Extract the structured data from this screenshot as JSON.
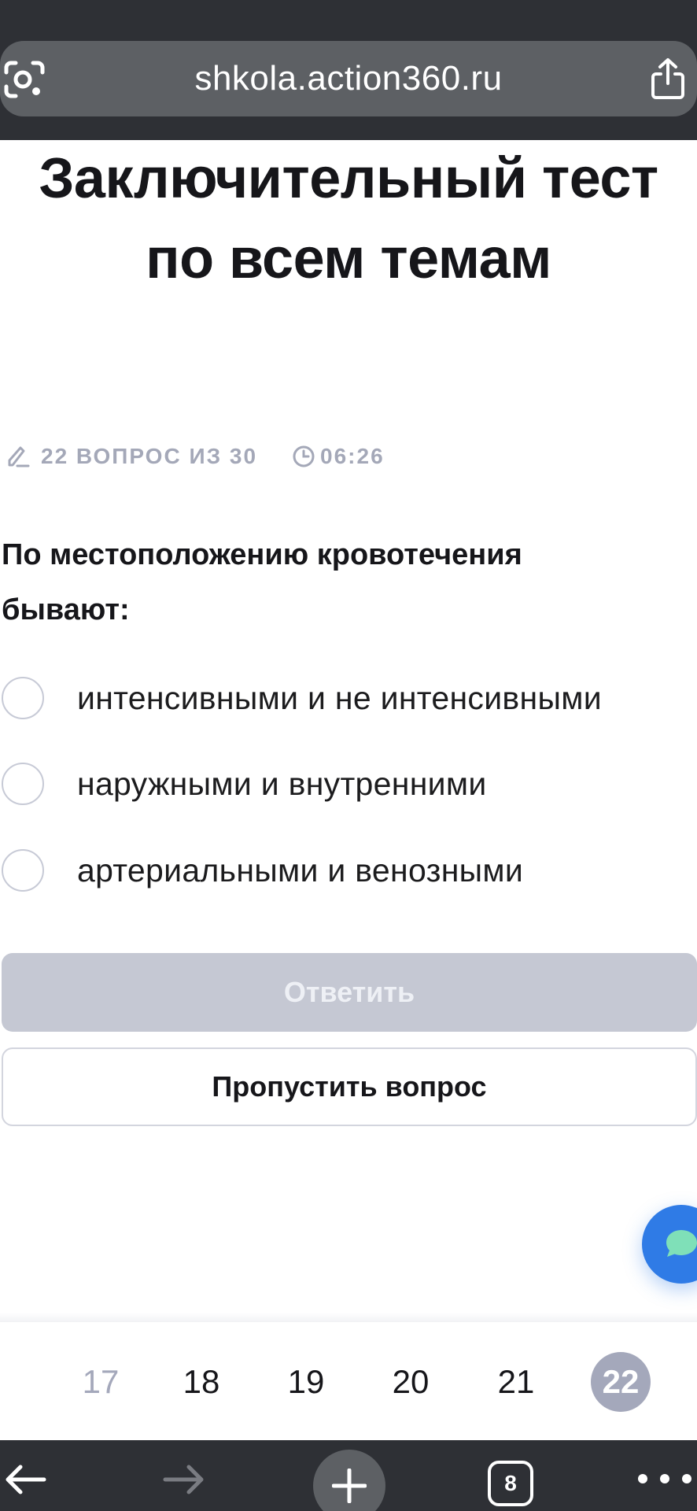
{
  "browser": {
    "url": "shkola.action360.ru",
    "tab_count": "8"
  },
  "test": {
    "title_line1": "Заключительный тест",
    "title_line2": "по всем темам",
    "progress_label": "22 ВОПРОС ИЗ 30",
    "timer": "06:26",
    "question_line1": "По местоположению кровотечения",
    "question_line2": "бывают:",
    "options": [
      {
        "label": "интенсивными и не интенсивными",
        "selected": false
      },
      {
        "label": "наружными и внутренними",
        "selected": false
      },
      {
        "label": "артериальными и венозными",
        "selected": false
      }
    ],
    "answer_button": "Ответить",
    "skip_button": "Пропустить вопрос"
  },
  "pager": {
    "pages": [
      "17",
      "18",
      "19",
      "20",
      "21",
      "22"
    ],
    "current": "22"
  },
  "colors": {
    "accent_chat": "#2f7be6",
    "disabled_button": "#c5c8d3",
    "muted": "#a4a8bb",
    "browser_chrome": "#2e3035"
  },
  "icons": {
    "lens": "lens-icon",
    "share": "share-icon",
    "pencil": "pencil-icon",
    "clock": "clock-icon",
    "chat": "chat-icon",
    "back": "arrow-left-icon",
    "forward": "arrow-right-icon",
    "new_tab": "plus-icon",
    "more": "more-icon"
  }
}
